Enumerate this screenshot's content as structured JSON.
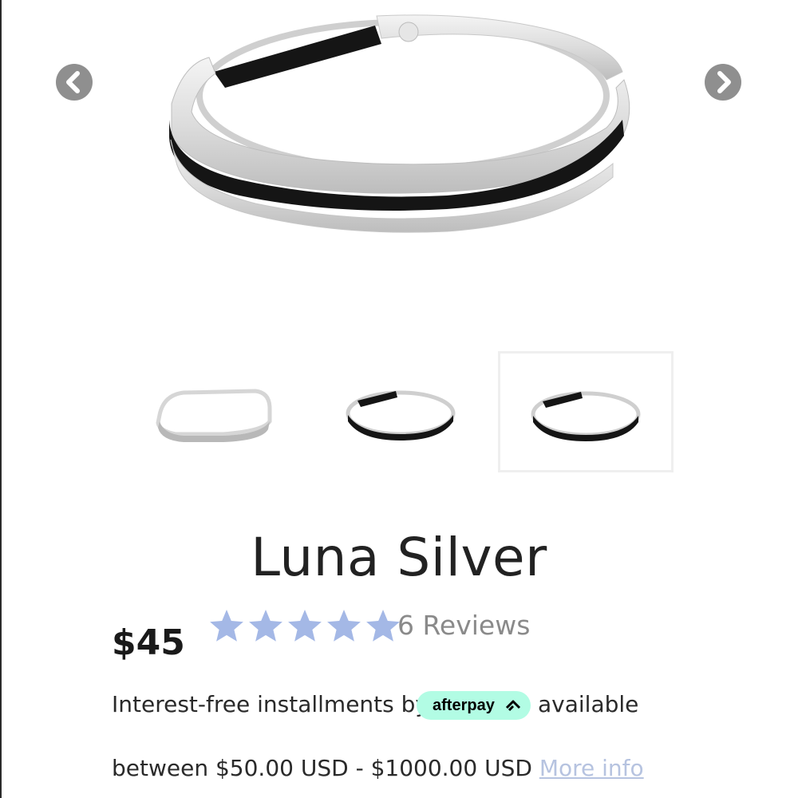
{
  "gallery": {
    "prev_icon": "chevron-left-icon",
    "next_icon": "chevron-right-icon",
    "thumbnails": [
      {
        "alt": ""
      },
      {
        "alt": ""
      },
      {
        "alt": ""
      }
    ],
    "selected_thumbnail": 3
  },
  "product": {
    "title": "Luna Silver",
    "price": "$45",
    "rating": 5,
    "star_color": "#a4b8e6",
    "reviews_label": "6 Reviews"
  },
  "afterpay": {
    "prefix": "Interest-free installments by",
    "badge_label": "afterpay",
    "badge_color": "#b2fce4",
    "suffix": "available",
    "range_text": "between $50.00 USD - $1000.00 USD",
    "more_info_label": "More info"
  }
}
